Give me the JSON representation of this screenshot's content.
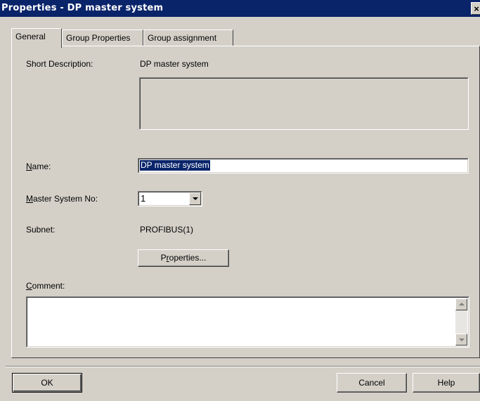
{
  "window": {
    "title": "Properties - DP master system",
    "close_glyph": "×"
  },
  "tabs": [
    {
      "label": "General",
      "active": true
    },
    {
      "label": "Group Properties",
      "active": false
    },
    {
      "label": "Group assignment",
      "active": false
    }
  ],
  "general": {
    "short_description_label": "Short Description:",
    "short_description_value": "DP master system",
    "name_label_accel": "N",
    "name_label_rest": "ame:",
    "name_value": "DP master system",
    "master_no_label_accel": "M",
    "master_no_label_rest": "aster System No:",
    "master_no_value": "1",
    "subnet_label": "Subnet:",
    "subnet_value": "PROFIBUS(1)",
    "properties_btn_pre": "P",
    "properties_btn_accel": "r",
    "properties_btn_post": "operties...",
    "comment_label_accel": "C",
    "comment_label_rest": "omment:",
    "comment_value": ""
  },
  "footer": {
    "ok_label": "OK",
    "cancel_label": "Cancel",
    "help_label": "Help"
  },
  "colors": {
    "titlebar": "#0a246a",
    "face": "#d4d0c8",
    "selection": "#0a246a"
  }
}
